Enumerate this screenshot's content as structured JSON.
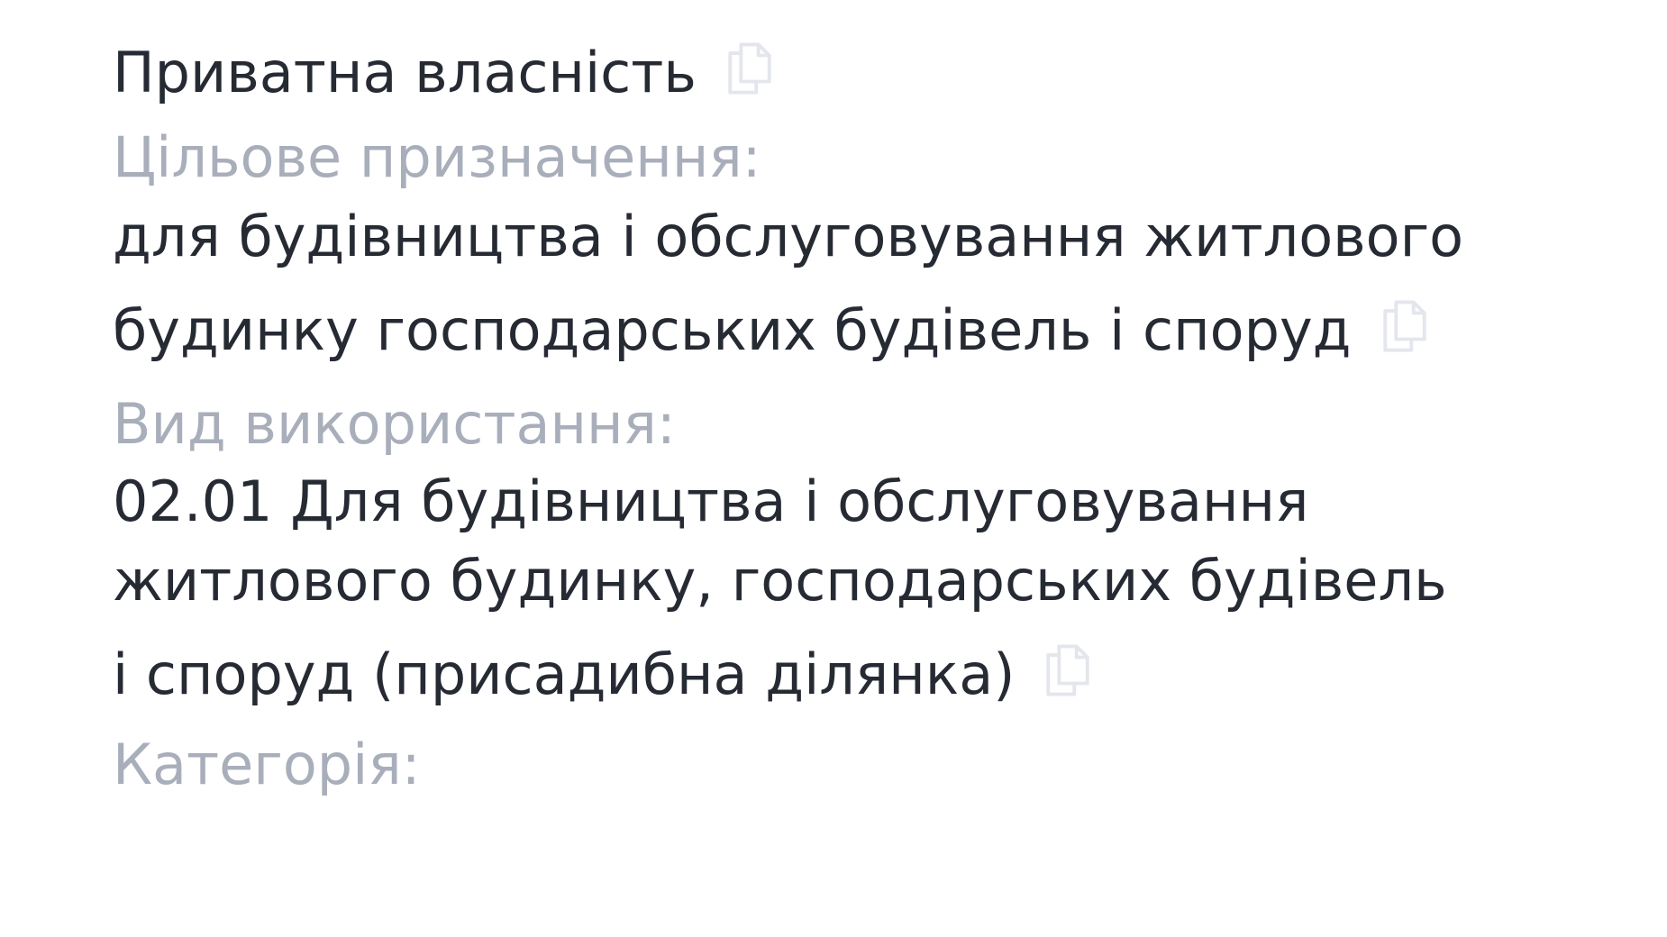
{
  "fields": {
    "ownership": {
      "value": "Приватна власність",
      "copy_icon": "copy-icon"
    },
    "purpose": {
      "label": "Цільове призначення:",
      "value_lines": [
        "для будівництва і обслуговування житлового",
        "будинку господарських будівель і споруд"
      ],
      "copy_icon": "copy-icon"
    },
    "usage": {
      "label": "Вид використання:",
      "value_lines": [
        "02.01 Для будівництва і обслуговування",
        "житлового будинку, господарських будівель",
        "і споруд (присадибна ділянка)"
      ],
      "copy_icon": "copy-icon"
    },
    "category": {
      "label": "Категорія:"
    }
  },
  "colors": {
    "value_text": "#262a33",
    "label_text": "#a9aebb",
    "icon": "#e3e6ec"
  }
}
